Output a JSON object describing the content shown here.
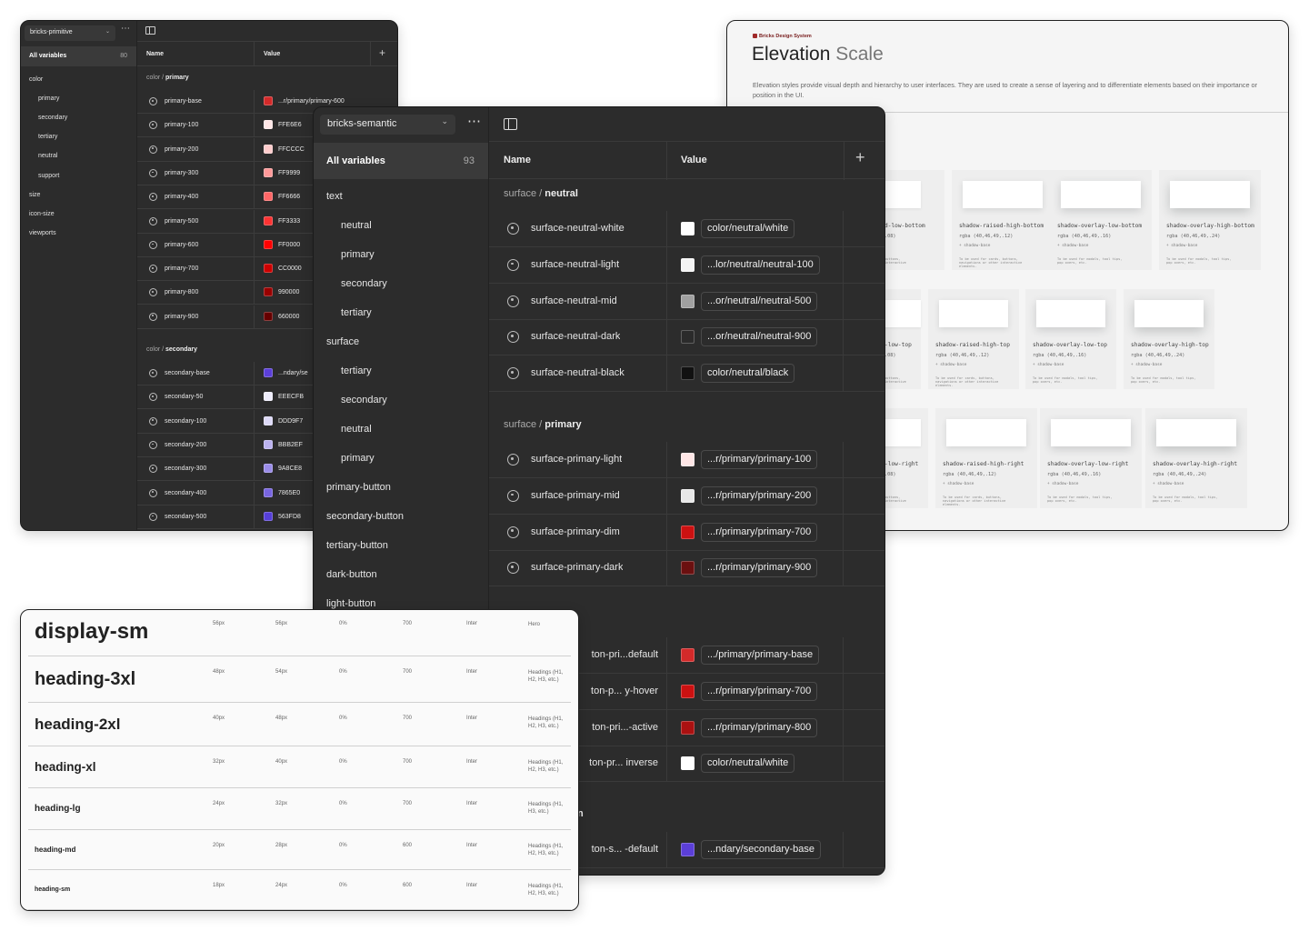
{
  "primitive": {
    "collection": "bricks-primitive",
    "all_variables_label": "All variables",
    "all_variables_count": "80",
    "groups": [
      "color",
      "primary",
      "secondary",
      "tertiary",
      "neutral",
      "support",
      "size",
      "icon-size",
      "viewports"
    ],
    "col_name": "Name",
    "col_value": "Value",
    "section1": {
      "prefix": "color / ",
      "name": "primary"
    },
    "section2": {
      "prefix": "color / ",
      "name": "secondary"
    },
    "rows1": [
      {
        "name": "primary-base",
        "value": "...r/primary/primary-600",
        "color": "#d32a2a"
      },
      {
        "name": "primary-100",
        "value": "FFE6E6",
        "color": "#ffe6e6"
      },
      {
        "name": "primary-200",
        "value": "FFCCCC",
        "color": "#ffcccc"
      },
      {
        "name": "primary-300",
        "value": "FF9999",
        "color": "#ff9999"
      },
      {
        "name": "primary-400",
        "value": "FF6666",
        "color": "#ff6666"
      },
      {
        "name": "primary-500",
        "value": "FF3333",
        "color": "#ff3333"
      },
      {
        "name": "primary-600",
        "value": "FF0000",
        "color": "#ff0000"
      },
      {
        "name": "primary-700",
        "value": "CC0000",
        "color": "#cc0000"
      },
      {
        "name": "primary-800",
        "value": "990000",
        "color": "#990000"
      },
      {
        "name": "primary-900",
        "value": "660000",
        "color": "#660000"
      }
    ],
    "rows2": [
      {
        "name": "secondary-base",
        "value": "...ndary/se",
        "color": "#5b3fd8"
      },
      {
        "name": "secondary-50",
        "value": "EEECFB",
        "color": "#eeecfb"
      },
      {
        "name": "secondary-100",
        "value": "DDD9F7",
        "color": "#ddd9f7"
      },
      {
        "name": "secondary-200",
        "value": "BBB2EF",
        "color": "#bbb2ef"
      },
      {
        "name": "secondary-300",
        "value": "9A8CE8",
        "color": "#9a8ce8"
      },
      {
        "name": "secondary-400",
        "value": "7865E0",
        "color": "#7865e0"
      },
      {
        "name": "secondary-500",
        "value": "563FD8",
        "color": "#563fd8"
      }
    ]
  },
  "semantic": {
    "collection": "bricks-semantic",
    "all_variables_label": "All variables",
    "all_variables_count": "93",
    "groups": [
      "text",
      "neutral",
      "primary",
      "secondary",
      "tertiary",
      "surface",
      "tertiary",
      "secondary",
      "neutral",
      "primary",
      "primary-button",
      "secondary-button",
      "tertiary-button",
      "dark-button",
      "light-button"
    ],
    "col_name": "Name",
    "col_value": "Value",
    "section1": {
      "prefix": "surface / ",
      "name": "neutral"
    },
    "section2": {
      "prefix": "surface / ",
      "name": "primary"
    },
    "section3_tail": "n",
    "rows1": [
      {
        "name": "surface-neutral-white",
        "value": "color/neutral/white",
        "color": "#ffffff"
      },
      {
        "name": "surface-neutral-light",
        "value": "...lor/neutral/neutral-100",
        "color": "#f4f4f4"
      },
      {
        "name": "surface-neutral-mid",
        "value": "...or/neutral/neutral-500",
        "color": "#a0a0a0"
      },
      {
        "name": "surface-neutral-dark",
        "value": "...or/neutral/neutral-900",
        "color": "#2b2b2b"
      },
      {
        "name": "surface-neutral-black",
        "value": "color/neutral/black",
        "color": "#111111"
      }
    ],
    "rows2": [
      {
        "name": "surface-primary-light",
        "value": "...r/primary/primary-100",
        "color": "#ffe6e6"
      },
      {
        "name": "surface-primary-mid",
        "value": "...r/primary/primary-200",
        "color": "#e8e8e8"
      },
      {
        "name": "surface-primary-dim",
        "value": "...r/primary/primary-700",
        "color": "#cc1111"
      },
      {
        "name": "surface-primary-dark",
        "value": "...r/primary/primary-900",
        "color": "#6b1010"
      }
    ],
    "rows3": [
      {
        "name": "ton-pri...default",
        "value": ".../primary/primary-base",
        "color": "#d32a2a"
      },
      {
        "name": "ton-p... y-hover",
        "value": "...r/primary/primary-700",
        "color": "#cc1111"
      },
      {
        "name": "ton-pri...-active",
        "value": "...r/primary/primary-800",
        "color": "#aa1111"
      },
      {
        "name": "ton-pr... inverse",
        "value": "color/neutral/white",
        "color": "#ffffff"
      }
    ],
    "rows4": [
      {
        "name": "ton-s... -default",
        "value": "...ndary/secondary-base",
        "color": "#5b3fd8"
      }
    ]
  },
  "elevation": {
    "brand": "Bricks Design System",
    "title_main": "Elevation",
    "title_sub": "Scale",
    "description": "Elevation styles provide visual depth and hierarchy to user interfaces. They are used to create a sense of layering and to differentiate elements based on their importance or position in the UI.",
    "row1": [
      {
        "name": "d-low-bottom",
        "rgba": ".08)",
        "base": "",
        "note": "buttons,\ninteractive"
      },
      {
        "name": "shadow-raised-high-bottom",
        "rgba": "rgba (40,46,49,.12)",
        "base": "+ shadow-base",
        "note": "To be used for cards, buttons,\nnavigations or other interactive\nelements."
      },
      {
        "name": "shadow-overlay-low-bottom",
        "rgba": "rgba (40,46,49,.16)",
        "base": "+ shadow-base",
        "note": "To be used for modals, tool tips,\npop overs, etc."
      },
      {
        "name": "shadow-overlay-high-bottom",
        "rgba": "rgba (40,46,49,.24)",
        "base": "+ shadow-base",
        "note": "To be used for modals, tool tips,\npop overs, etc."
      }
    ],
    "row2": [
      {
        "name": "-low-top",
        "rgba": ".08)",
        "base": "",
        "note": "buttons,\ninteractive"
      },
      {
        "name": "shadow-raised-high-top",
        "rgba": "rgba (40,46,49,.12)",
        "base": "+ shadow-base",
        "note": "To be used for cards, buttons,\nnavigations or other interactive\nelements."
      },
      {
        "name": "shadow-overlay-low-top",
        "rgba": "rgba (40,46,49,.16)",
        "base": "+ shadow-base",
        "note": "To be used for modals, tool tips,\npop overs, etc."
      },
      {
        "name": "shadow-overlay-high-top",
        "rgba": "rgba (40,46,49,.24)",
        "base": "+ shadow-base",
        "note": "To be used for modals, tool tips,\npop overs, etc."
      }
    ],
    "row3": [
      {
        "name": "-low-right",
        "rgba": ".08)",
        "base": "",
        "note": "buttons,\ninteractive"
      },
      {
        "name": "shadow-raised-high-right",
        "rgba": "rgba (40,46,49,.12)",
        "base": "+ shadow-base",
        "note": "To be used for cards, buttons,\nnavigations or other interactive\nelements."
      },
      {
        "name": "shadow-overlay-low-right",
        "rgba": "rgba (40,46,49,.16)",
        "base": "+ shadow-base",
        "note": "To be used for modals, tool tips,\npop overs, etc."
      },
      {
        "name": "shadow-overlay-high-right",
        "rgba": "rgba (40,46,49,.24)",
        "base": "+ shadow-base",
        "note": "To be used for modals, tool tips,\npop overs, etc."
      }
    ]
  },
  "typography": {
    "rows": [
      {
        "name": "display-sm",
        "size": "56px",
        "line": "56px",
        "tracking": "0%",
        "weight": "700",
        "font": "Inter",
        "usage": "Hero"
      },
      {
        "name": "heading-3xl",
        "size": "48px",
        "line": "54px",
        "tracking": "0%",
        "weight": "700",
        "font": "Inter",
        "usage": "Headings (H1, H2, H3, etc.)"
      },
      {
        "name": "heading-2xl",
        "size": "40px",
        "line": "48px",
        "tracking": "0%",
        "weight": "700",
        "font": "Inter",
        "usage": "Headings (H1, H2, H3, etc.)"
      },
      {
        "name": "heading-xl",
        "size": "32px",
        "line": "40px",
        "tracking": "0%",
        "weight": "700",
        "font": "Inter",
        "usage": "Headings (H1, H2, H3, etc.)"
      },
      {
        "name": "heading-lg",
        "size": "24px",
        "line": "32px",
        "tracking": "0%",
        "weight": "700",
        "font": "Inter",
        "usage": "Headings (H1, H3, etc.)"
      },
      {
        "name": "heading-md",
        "size": "20px",
        "line": "28px",
        "tracking": "0%",
        "weight": "600",
        "font": "Inter",
        "usage": "Headings (H1, H2, H3, etc.)"
      },
      {
        "name": "heading-sm",
        "size": "18px",
        "line": "24px",
        "tracking": "0%",
        "weight": "600",
        "font": "Inter",
        "usage": "Headings (H1, H2, H3, etc.)"
      }
    ]
  }
}
